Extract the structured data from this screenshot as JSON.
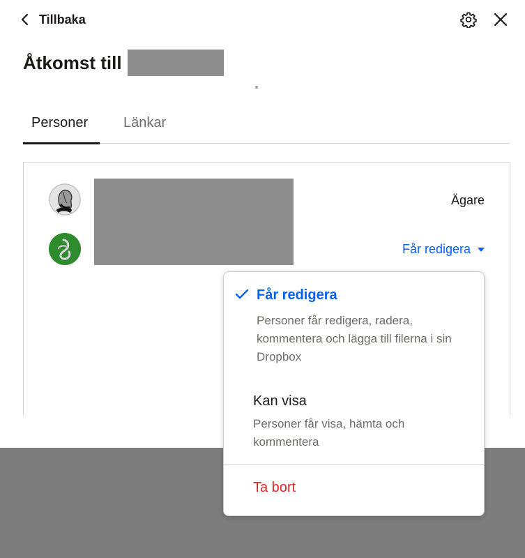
{
  "header": {
    "back_label": "Tillbaka",
    "settings_icon": "gear-icon",
    "close_icon": "close-icon"
  },
  "title": {
    "prefix": "Åtkomst till"
  },
  "tabs": [
    {
      "label": "Personer",
      "active": true
    },
    {
      "label": "Länkar",
      "active": false
    }
  ],
  "members": [
    {
      "role": "Ägare"
    },
    {
      "role": "Får redigera"
    }
  ],
  "menu": {
    "options": [
      {
        "title": "Får redigera",
        "description": "Personer får redigera, radera, kommentera och lägga till filerna i sin Dropbox",
        "selected": true
      },
      {
        "title": "Kan visa",
        "description": "Personer får visa, hämta och kommentera",
        "selected": false
      }
    ],
    "remove_label": "Ta bort"
  },
  "colors": {
    "accent": "#0061fe",
    "danger": "#e02424",
    "text": "#1e1919",
    "muted": "#6f6b68"
  }
}
